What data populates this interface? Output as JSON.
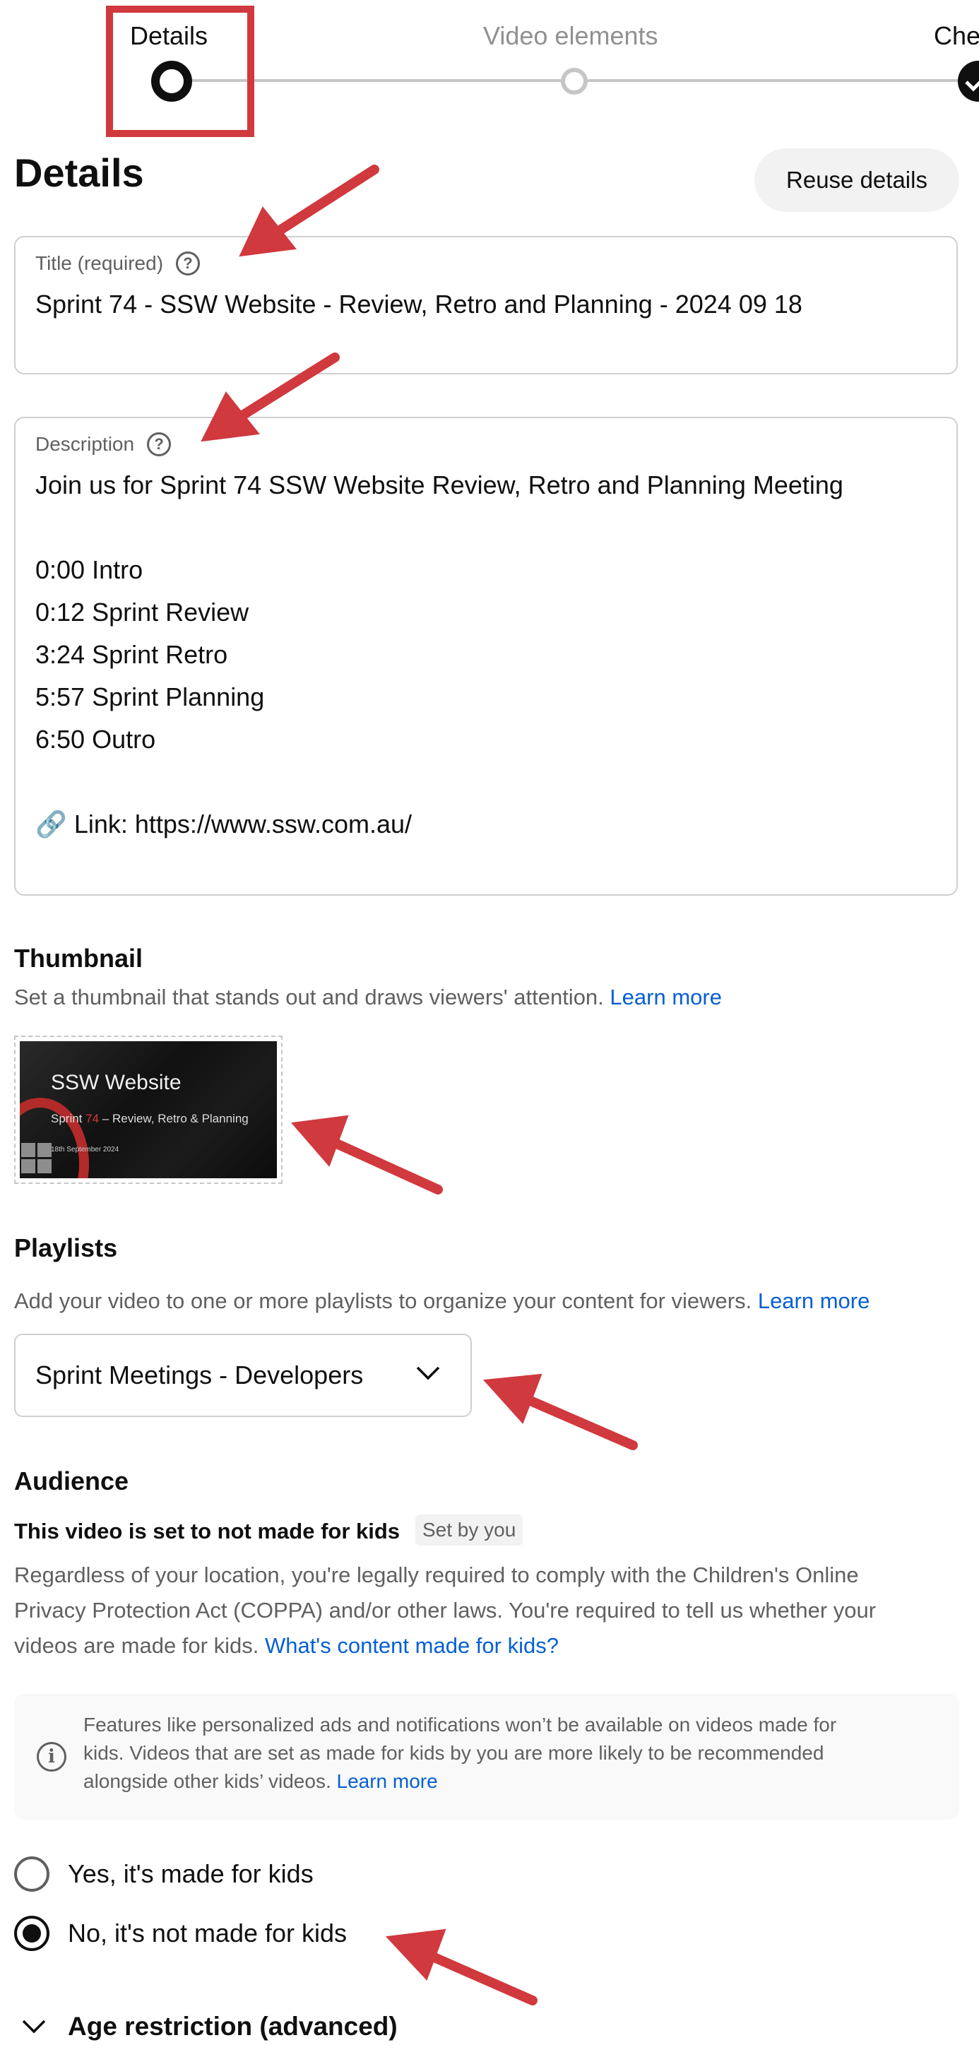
{
  "stepper": {
    "steps": [
      {
        "label": "Details"
      },
      {
        "label": "Video elements"
      },
      {
        "label": "Che"
      }
    ]
  },
  "header": {
    "title": "Details",
    "reuse_button": "Reuse details"
  },
  "title_field": {
    "label": "Title (required)",
    "value": "Sprint 74 - SSW Website - Review, Retro and Planning - 2024 09 18"
  },
  "description_field": {
    "label": "Description",
    "lines": [
      "Join us for Sprint 74 SSW Website Review, Retro and Planning Meeting",
      "0:00 Intro",
      "0:12 Sprint Review",
      "3:24 Sprint Retro",
      "5:57 Sprint Planning",
      "6:50 Outro",
      "🔗 Link: https://www.ssw.com.au/"
    ]
  },
  "thumbnail": {
    "heading": "Thumbnail",
    "subtitle": "Set a thumbnail that stands out and draws viewers' attention.",
    "learn_more": "Learn more",
    "image_title": "SSW Website",
    "image_line_prefix": "Sprint ",
    "image_line_number": "74",
    "image_line_suffix": " – Review, Retro & Planning",
    "image_date": "18th September 2024"
  },
  "playlists": {
    "heading": "Playlists",
    "subtitle": "Add your video to one or more playlists to organize your content for viewers.",
    "learn_more": "Learn more",
    "selected": "Sprint Meetings - Developers"
  },
  "audience": {
    "heading": "Audience",
    "status": "This video is set to not made for kids",
    "badge": "Set by you",
    "paragraph_lines": [
      "Regardless of your location, you're legally required to comply with the Children's Online",
      "Privacy Protection Act (COPPA) and/or other laws. You're required to tell us whether your",
      "videos are made for kids."
    ],
    "paragraph_link": "What's content made for kids?",
    "info_lines": [
      "Features like personalized ads and notifications won’t be available on videos made for",
      "kids. Videos that are set as made for kids by you are more likely to be recommended",
      "alongside other kids’ videos."
    ],
    "info_link": "Learn more",
    "options": [
      {
        "label": "Yes, it's made for kids",
        "selected": false
      },
      {
        "label": "No, it's not made for kids",
        "selected": true
      }
    ],
    "age_restriction": "Age restriction (advanced)"
  },
  "colors": {
    "annotation_red": "#d0393e",
    "link_blue": "#065fd4"
  }
}
